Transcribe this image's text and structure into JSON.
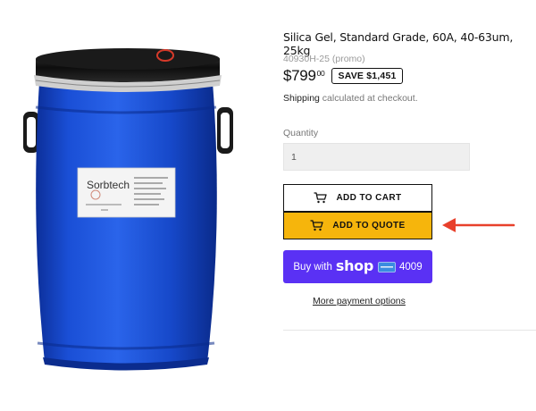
{
  "product": {
    "title": "Silica Gel, Standard Grade, 60A, 40-63um, 25kg",
    "sku": "40930H-25 (promo)",
    "price_main": "$799",
    "price_cents": "00",
    "save_badge": "SAVE $1,451",
    "shipping_link": "Shipping",
    "shipping_text": " calculated at checkout.",
    "label_brand": "Sorbtech",
    "image_desc_icon": "blue-barrel"
  },
  "quantity": {
    "label": "Quantity",
    "value": "1"
  },
  "buttons": {
    "add_to_cart": "ADD TO CART",
    "add_to_quote": "ADD TO QUOTE",
    "buy_with_prefix": "Buy with",
    "shop_logo": "shop",
    "card_last4": "4009",
    "more_payment": "More payment options"
  },
  "colors": {
    "quote_button": "#f6b50c",
    "shop_pay": "#5a31f4",
    "barrel": "#1346c9",
    "annotation_arrow": "#e8402b"
  }
}
